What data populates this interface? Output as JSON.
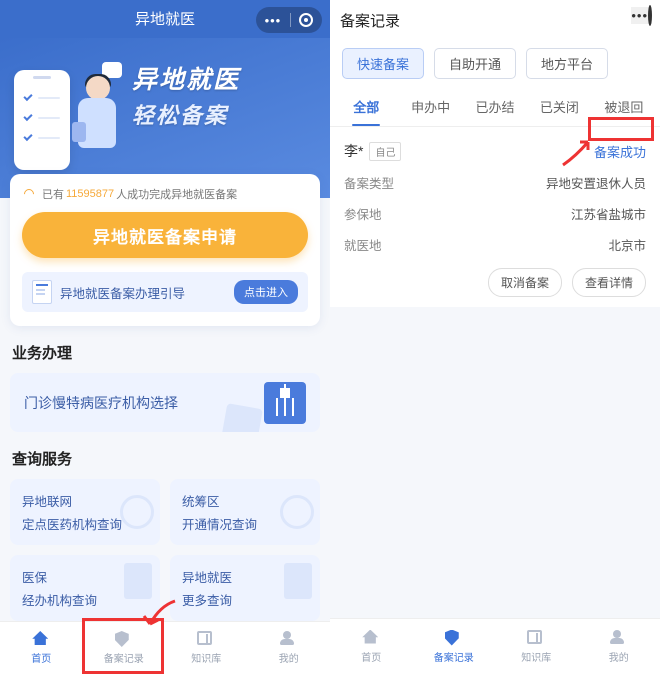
{
  "left": {
    "title": "异地就医",
    "hero": {
      "line1": "异地就医",
      "line2": "轻松备案"
    },
    "notice": {
      "prefix": "已有",
      "count": "11595877",
      "suffix": "人成功完成异地就医备案"
    },
    "apply_btn": "异地就医备案申请",
    "guide": {
      "label": "异地就医备案办理引导",
      "btn": "点击进入"
    },
    "sec_biz": "业务办理",
    "biz_item": "门诊慢特病医疗机构选择",
    "sec_query": "查询服务",
    "q": [
      {
        "l1": "异地联网",
        "l2": "定点医药机构查询"
      },
      {
        "l1": "统筹区",
        "l2": "开通情况查询"
      },
      {
        "l1": "医保",
        "l2": "经办机构查询"
      },
      {
        "l1": "异地就医",
        "l2": "更多查询"
      }
    ],
    "tabs": [
      "首页",
      "备案记录",
      "知识库",
      "我的"
    ]
  },
  "right": {
    "title": "备案记录",
    "pills": [
      "快速备案",
      "自助开通",
      "地方平台"
    ],
    "tabs": [
      "全部",
      "申办中",
      "已办结",
      "已关闭",
      "被退回"
    ],
    "record": {
      "name": "李*",
      "rel": "自己",
      "status": "备案成功",
      "rows": [
        {
          "k": "备案类型",
          "v": "异地安置退休人员"
        },
        {
          "k": "参保地",
          "v": "江苏省盐城市"
        },
        {
          "k": "就医地",
          "v": "北京市"
        }
      ],
      "actions": [
        "取消备案",
        "查看详情"
      ]
    },
    "tabs_bottom": [
      "首页",
      "备案记录",
      "知识库",
      "我的"
    ]
  }
}
